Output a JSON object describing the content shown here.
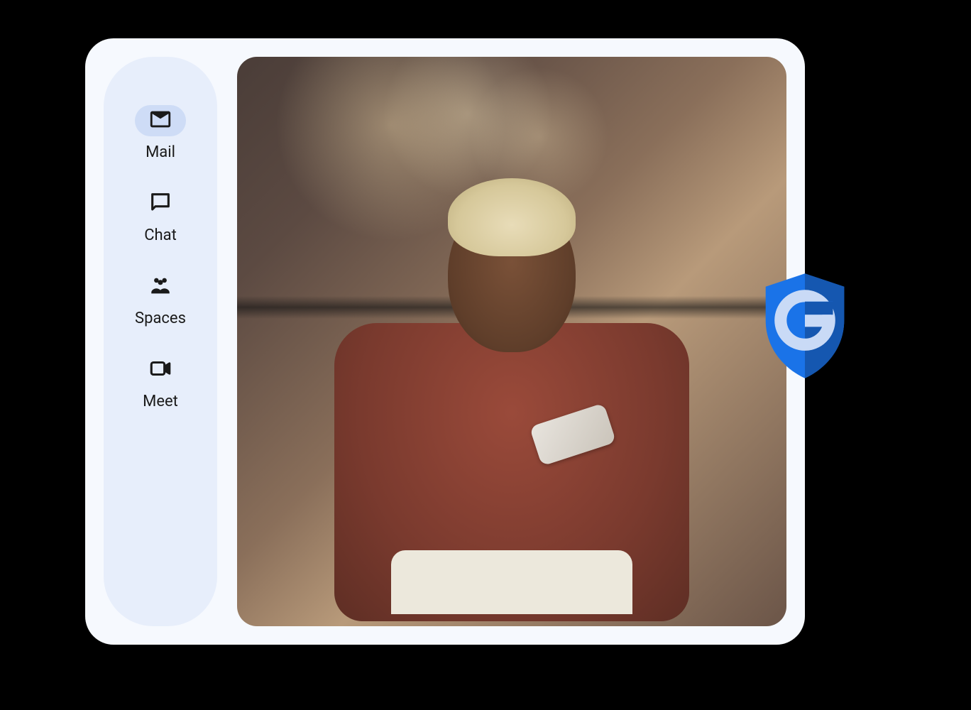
{
  "sidebar": {
    "items": [
      {
        "label": "Mail",
        "icon": "mail-icon",
        "active": true
      },
      {
        "label": "Chat",
        "icon": "chat-icon",
        "active": false
      },
      {
        "label": "Spaces",
        "icon": "spaces-icon",
        "active": false
      },
      {
        "label": "Meet",
        "icon": "meet-icon",
        "active": false
      }
    ]
  },
  "badge": {
    "icon": "google-shield-icon",
    "letter": "G",
    "background_color": "#1a73e8",
    "letter_color": "#c9daf6"
  },
  "photo": {
    "description": "Person with short blonde hair in rust-colored top looking at smartphone in office setting"
  }
}
